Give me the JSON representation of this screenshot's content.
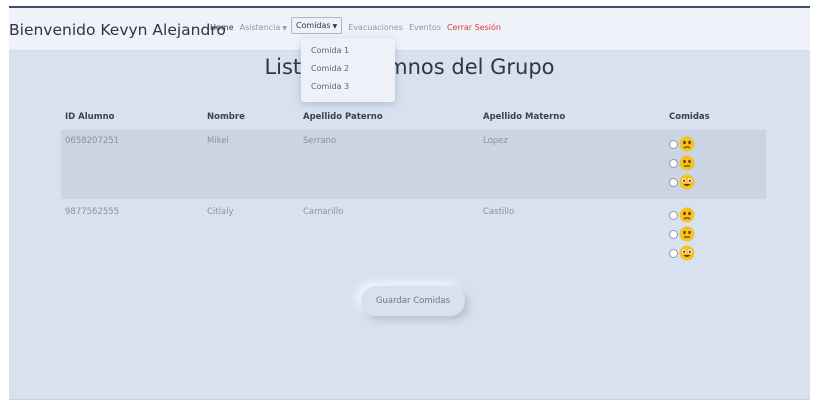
{
  "navbar": {
    "brand": "Bienvenido Kevyn Alejandro",
    "links": {
      "home": "Home",
      "asistencia": "Asistencia",
      "comidas": "Comidas",
      "evacuaciones": "Evacuaciones",
      "eventos": "Eventos",
      "logout": "Cerrar Sesión"
    },
    "comidas_menu": [
      "Comida 1",
      "Comida 2",
      "Comida 3"
    ]
  },
  "page": {
    "title": "Lista de Alumnos del Grupo"
  },
  "table": {
    "headers": [
      "ID Alumno",
      "Nombre",
      "Apellido Paterno",
      "Apellido Materno",
      "Comidas"
    ],
    "rows": [
      [
        "0658207251",
        "Mikel",
        "Serrano",
        "Lopez"
      ],
      [
        "9877562555",
        "Citlaly",
        "Camarillo",
        "Castillo"
      ]
    ],
    "meal_options": [
      "sad-face-icon",
      "neutral-face-icon",
      "happy-face-icon"
    ]
  },
  "actions": {
    "save_label": "Guardar Comidas"
  },
  "colors": {
    "background": "#d8e1ef",
    "navbar": "#eff3f9",
    "row_highlight": "#cbd4e2",
    "logout": "#d63c3c",
    "emoji": "#f7c21b"
  }
}
